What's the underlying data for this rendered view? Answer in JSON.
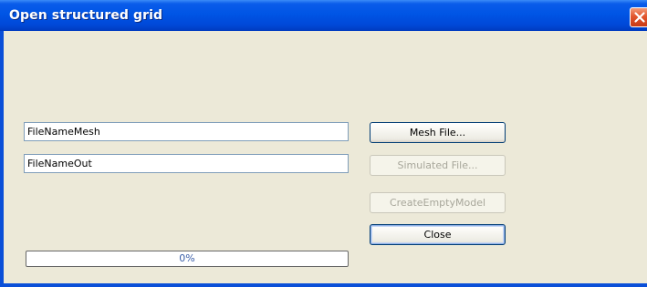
{
  "window": {
    "title": "Open structured grid"
  },
  "fields": {
    "mesh_file_value": "FileNameMesh",
    "out_file_value": "FileNameOut"
  },
  "buttons": {
    "mesh_file": "Mesh File...",
    "simulated_file": "Simulated File...",
    "create_empty_model": "CreateEmptyModel",
    "close": "Close"
  },
  "progress": {
    "label": "0%",
    "value": 0
  },
  "colors": {
    "titlebar": "#0055e5",
    "client_background": "#ece9d8",
    "close_button": "#e2552d"
  },
  "icons": {
    "window_close": "close-x-icon"
  }
}
